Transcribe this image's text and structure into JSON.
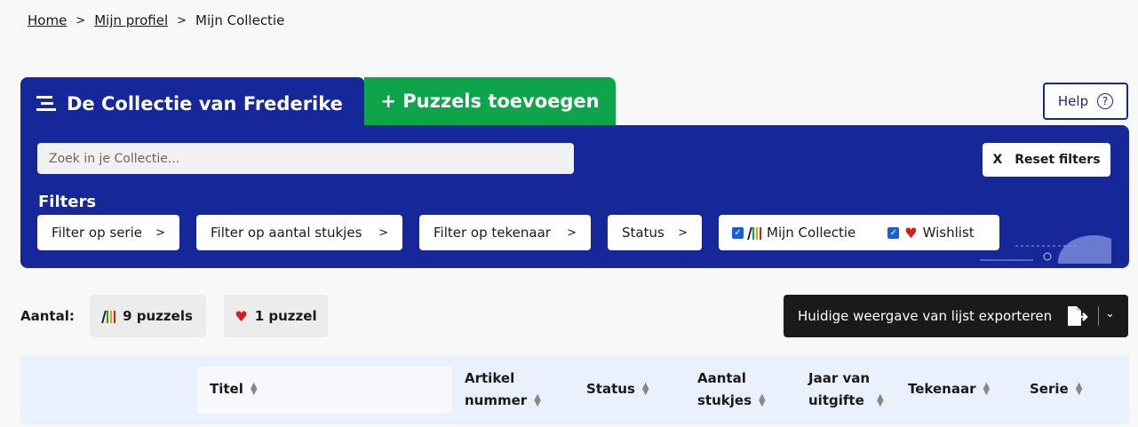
{
  "breadcrumb": {
    "home": "Home",
    "profile": "Mijn profiel",
    "current": "Mijn Collectie"
  },
  "tabs": {
    "collection": "De Collectie van Frederike",
    "add": "+ Puzzels toevoegen"
  },
  "help": {
    "label": "Help",
    "icon": "?"
  },
  "search": {
    "placeholder": "Zoek in je Collectie..."
  },
  "reset": {
    "icon": "X",
    "label": "Reset filters"
  },
  "filters": {
    "heading": "Filters",
    "buttons": [
      "Filter op serie",
      "Filter op aantal stukjes",
      "Filter op tekenaar",
      "Status"
    ],
    "checks": {
      "collection": "Mijn Collectie",
      "wishlist": "Wishlist"
    }
  },
  "counts": {
    "label": "Aantal:",
    "puzzles": "9 puzzels",
    "wishlist": "1 puzzel"
  },
  "export": {
    "label": "Huidige weergave van lijst exporteren"
  },
  "table": {
    "headers": {
      "titel": "Titel",
      "artikel1": "Artikel",
      "artikel2": "nummer",
      "status": "Status",
      "aantal1": "Aantal",
      "aantal2": "stukjes",
      "jaar1": "Jaar van",
      "jaar2": "uitgifte",
      "tekenaar": "Tekenaar",
      "serie": "Serie"
    }
  },
  "colors": {
    "navy": "#16279a",
    "green": "#0ea44a",
    "heart": "#d61c1c"
  }
}
